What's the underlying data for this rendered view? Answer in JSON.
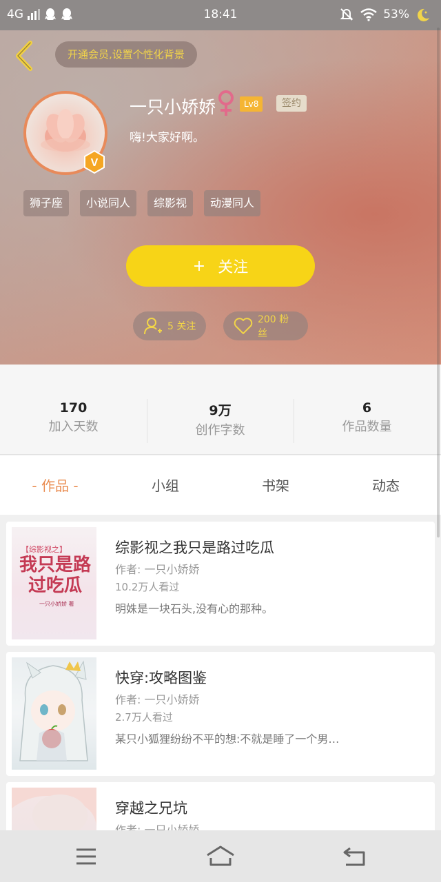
{
  "status_bar": {
    "network": "4G",
    "time": "18:41",
    "battery": "53%"
  },
  "header": {
    "vip_banner": "开通会员,设置个性化背景",
    "username": "一只小娇娇",
    "level": "Lv8",
    "sign_badge": "签约",
    "bio": "嗨!大家好啊。",
    "tags": [
      "狮子座",
      "小说同人",
      "综影视",
      "动漫同人"
    ],
    "follow_button": "关注",
    "follow_plus": "+",
    "following": "5 关注",
    "fans": "200 粉丝",
    "vip_badge": "V"
  },
  "stats": [
    {
      "value": "170",
      "label": "加入天数"
    },
    {
      "value": "9万",
      "label": "创作字数"
    },
    {
      "value": "6",
      "label": "作品数量"
    }
  ],
  "tabs": [
    "- 作品 -",
    "小组",
    "书架",
    "动态"
  ],
  "books": [
    {
      "title": "综影视之我只是路过吃瓜",
      "author": "作者: 一只小娇娇",
      "views": "10.2万人看过",
      "desc": "明姝是一块石头,没有心的那种。",
      "cover_sub": "【综影视之】",
      "cover_title": "我只是路过吃瓜",
      "cover_author": "一只小娇娇 著"
    },
    {
      "title": "快穿:攻略图鉴",
      "author": "作者: 一只小娇娇",
      "views": "2.7万人看过",
      "desc": "某只小狐狸纷纷不平的想:不就是睡了一个男…"
    },
    {
      "title": "穿越之兄坑",
      "author": "作者: 一只小娇娇",
      "views": "",
      "desc": ""
    }
  ],
  "colors": {
    "accent_yellow": "#f7d417",
    "tab_active": "#e98b4f",
    "avatar_border": "#e88a5a"
  }
}
